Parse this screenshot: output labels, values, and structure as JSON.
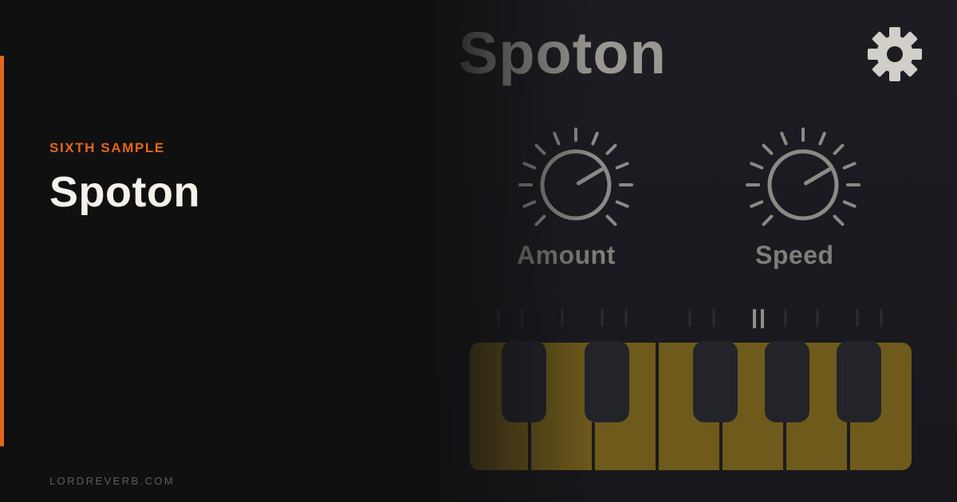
{
  "left_panel": {
    "brand": "SIXTH SAMPLE",
    "product": "Spoton",
    "site": "LORDREVERB.COM",
    "accent_color": "#e2661b"
  },
  "plugin_ui": {
    "title": "Spoton",
    "settings_icon": "gear-icon",
    "knobs": [
      {
        "label": "Amount",
        "level": 0.72
      },
      {
        "label": "Speed",
        "level": 0.72
      }
    ],
    "keyboard": {
      "key_color": "#6e5a1a",
      "white_key_count": 7,
      "black_key_count": 5,
      "active_marker": "||"
    }
  }
}
